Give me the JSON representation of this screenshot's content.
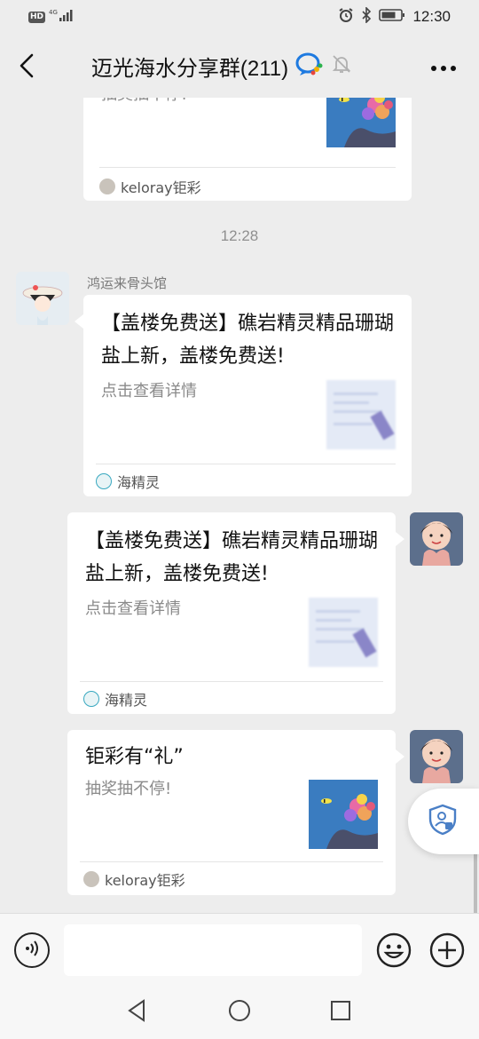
{
  "status_bar": {
    "hd_label": "HD",
    "network": "4G",
    "time": "12:30"
  },
  "header": {
    "title": "迈光海水分享群(211)",
    "back_icon": "chevron-left-icon",
    "more_icon": "more-dots-icon"
  },
  "messages": {
    "top_card": {
      "title_partial": "抽奖抽不停!",
      "source": "keloray钜彩"
    },
    "timestamp": "12:28",
    "msg1": {
      "sender": "鸿运来骨头馆",
      "title": "【盖楼免费送】礁岩精灵精品珊瑚盐上新，盖楼免费送!",
      "desc": "点击查看详情",
      "source": "海精灵"
    },
    "msg2": {
      "title": "【盖楼免费送】礁岩精灵精品珊瑚盐上新，盖楼免费送!",
      "desc": "点击查看详情",
      "source": "海精灵"
    },
    "msg3": {
      "title": "钜彩有“礼”",
      "desc": "抽奖抽不停!",
      "source": "keloray钜彩"
    }
  },
  "colors": {
    "background": "#ededed",
    "bubble": "#ffffff",
    "accent": "#1aad19"
  }
}
